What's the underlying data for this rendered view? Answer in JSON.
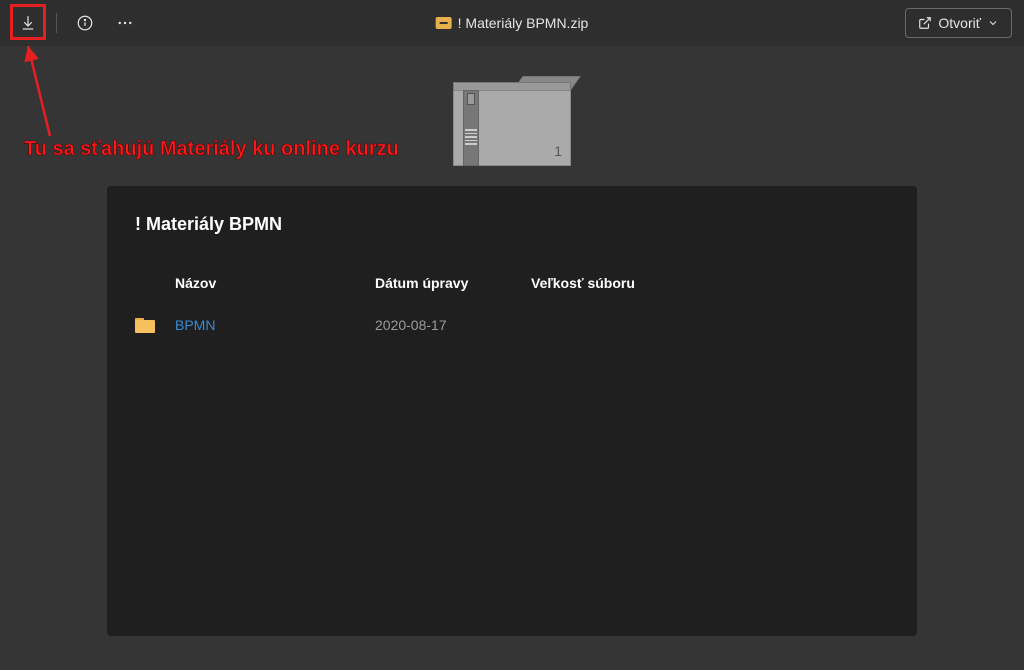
{
  "toolbar": {
    "title": "! Materiály BPMN.zip",
    "open_button": "Otvoriť"
  },
  "annotation": {
    "text": "Tu sa sťahujú Materiály ku online kurzu"
  },
  "folder_preview": {
    "count": "1",
    "panel_title": "! Materiály BPMN",
    "columns": {
      "name": "Názov",
      "date": "Dátum úpravy",
      "size": "Veľkosť súboru"
    },
    "rows": [
      {
        "name": "BPMN",
        "date": "2020-08-17",
        "size": ""
      }
    ]
  }
}
